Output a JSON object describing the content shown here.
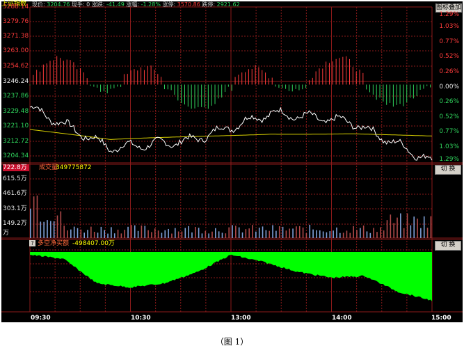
{
  "index_name": "上证指数",
  "status": {
    "price_label": "现价:",
    "price": "3204.76",
    "hand_label": "现手:",
    "hand": "0",
    "change_label": "涨跌:",
    "change": "-41.49",
    "pct_label": "涨幅:",
    "pct": "-1.28%",
    "up_label": "涨停:",
    "up_limit": "3570.86",
    "down_label": "跌停:",
    "down_limit": "2921.62"
  },
  "overlay_button": "图标叠加",
  "price_axis": [
    "3288.14",
    "3279.76",
    "3271.38",
    "3263.00",
    "3254.62",
    "3246.24",
    "3237.86",
    "3229.48",
    "3221.10",
    "3212.72",
    "3204.34"
  ],
  "pct_axis": [
    "1.29%",
    "1.03%",
    "0.77%",
    "0.52%",
    "0.26%",
    "0.00%",
    "0.26%",
    "0.52%",
    "0.77%",
    "1.03%",
    "1.29%"
  ],
  "volume": {
    "title": "成交量",
    "value": "349775872",
    "axis": [
      "722.8万",
      "615.5万",
      "461.6万",
      "303.1万",
      "149.2万",
      "万"
    ],
    "switch_label": "切 换"
  },
  "net_flow": {
    "icon_label": "?",
    "title": "多空净买额",
    "value": "-498407.00万",
    "switch_label": "切 换"
  },
  "time_axis": [
    "09:30",
    "10:30",
    "13:00",
    "14:00",
    "15:00"
  ],
  "caption": "（图 1）",
  "chart_data": {
    "type": "line",
    "x": [
      "09:30",
      "10:30",
      "13:00",
      "14:00",
      "15:00"
    ],
    "ylim": [
      3204.34,
      3288.14
    ],
    "prev_close": 3246.24,
    "series": [
      {
        "values": [
          3234,
          3212,
          3216,
          3231,
          3226,
          3204.76
        ]
      },
      {
        "values": [
          3222,
          3216,
          3218,
          3220,
          3220,
          3218
        ]
      }
    ]
  },
  "colors": {
    "background": "#000000",
    "grid": "#8b1a1a",
    "up": "#ff3b3b",
    "down": "#2fd35c",
    "price_line": "#ffffff",
    "avg_line": "#d8d000",
    "net_flow": "#00ff00",
    "volume_bar": "#b04a4a"
  }
}
